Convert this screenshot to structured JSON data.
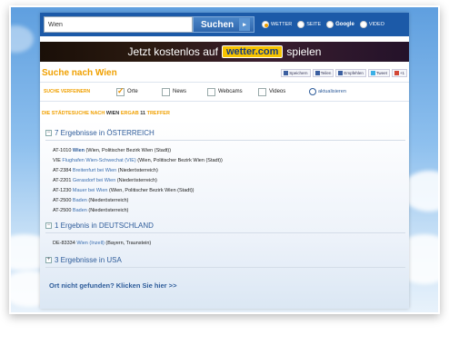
{
  "search": {
    "value": "Wien",
    "button_label": "Suchen",
    "button_arrow": "▸",
    "options": [
      {
        "label": "WETTER",
        "selected": true
      },
      {
        "label": "SEITE",
        "selected": false
      },
      {
        "label": "Google",
        "selected": false
      },
      {
        "label": "VIDEO",
        "selected": false
      }
    ]
  },
  "banner": {
    "text_before": "Jetzt kostenlos auf",
    "brand": "wetter.com",
    "text_after": "spielen"
  },
  "title": "Suche nach Wien",
  "share": {
    "bookmark": "Speichern",
    "share": "Teilen",
    "like": "Empfehlen",
    "tweet": "Tweet",
    "plusone": "+1"
  },
  "refine": {
    "label": "SUCHE VERFEINERN",
    "filters": [
      {
        "label": "Orte",
        "checked": true
      },
      {
        "label": "News",
        "checked": false
      },
      {
        "label": "Webcams",
        "checked": false
      },
      {
        "label": "Videos",
        "checked": false
      }
    ],
    "refresh": "aktualisieren"
  },
  "summary": {
    "prefix": "DIE STÄDTESUCHE NACH",
    "term": "WIEN",
    "middle": "ERGAB",
    "count": "11",
    "suffix": "TREFFER"
  },
  "groups": [
    {
      "title": "7 Ergebnisse in ÖSTERREICH",
      "toggle": "−",
      "entries": [
        {
          "code": "AT-1010",
          "place": "Wien",
          "detail": "(Wien, Politischer Bezirk Wien (Stadt))"
        },
        {
          "code": "VIE",
          "place": "Flughafen Wien-Schwechat (VIE)",
          "detail": "(Wien, Politischer Bezirk Wien (Stadt))"
        },
        {
          "code": "AT-2384",
          "place": "Breitenfurt bei Wien",
          "detail": "(Niederösterreich)"
        },
        {
          "code": "AT-2201",
          "place": "Gerasdorf bei Wien",
          "detail": "(Niederösterreich)"
        },
        {
          "code": "AT-1230",
          "place": "Mauer bei Wien",
          "detail": "(Wien, Politischer Bezirk Wien (Stadt))"
        },
        {
          "code": "AT-2500",
          "place": "Baden",
          "detail": "(Niederösterreich)"
        },
        {
          "code": "AT-2500",
          "place": "Baden",
          "detail": "(Niederösterreich)"
        }
      ]
    },
    {
      "title": "1 Ergebnis in DEUTSCHLAND",
      "toggle": "−",
      "entries": [
        {
          "code": "DE-83334",
          "place": "Wien (Inzell)",
          "detail": "(Bayern, Traunstein)"
        }
      ]
    },
    {
      "title": "3 Ergebnisse in USA",
      "toggle": "+",
      "entries": []
    }
  ],
  "not_found": "Ort nicht gefunden? Klicken Sie hier >>",
  "colors": {
    "accent": "#f0a000",
    "link": "#2e5c9a",
    "bar": "#1c5aa8"
  }
}
